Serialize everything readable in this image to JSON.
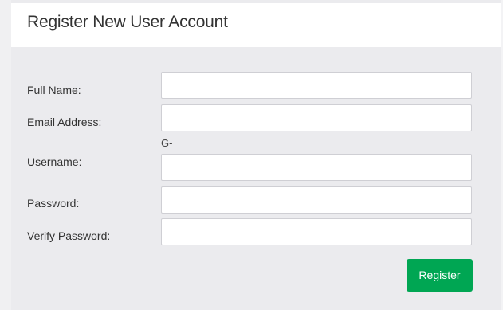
{
  "form": {
    "title": "Register New User Account",
    "fields": {
      "full_name": {
        "label": "Full Name:",
        "value": "",
        "placeholder": ""
      },
      "email": {
        "label": "Email Address:",
        "value": "",
        "placeholder": ""
      },
      "username": {
        "label": "Username:",
        "prefix_note": "G-",
        "value": "",
        "placeholder": ""
      },
      "password": {
        "label": "Password:",
        "value": "",
        "placeholder": ""
      },
      "verify_password": {
        "label": "Verify Password:",
        "value": "",
        "placeholder": ""
      }
    },
    "submit_label": "Register"
  },
  "colors": {
    "accent": "#00a653",
    "background": "#ebebee",
    "header_background": "#ffffff"
  }
}
